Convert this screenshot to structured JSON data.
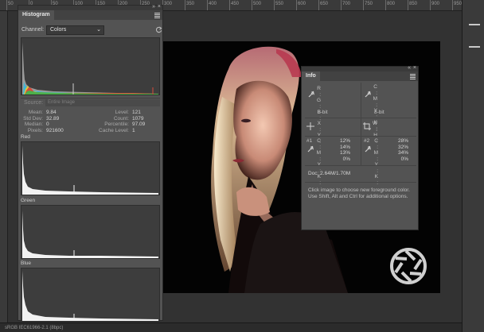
{
  "rulers": {
    "top_labels": [
      "50",
      "0",
      "50",
      "100",
      "150",
      "200",
      "250",
      "300",
      "350",
      "400",
      "450",
      "500",
      "550",
      "600",
      "650",
      "700",
      "750",
      "800",
      "850",
      "900",
      "950"
    ]
  },
  "status": {
    "text": "sRGB IEC61966-2.1 (8bpc)"
  },
  "histogram": {
    "tab": "Histogram",
    "channel_label": "Channel:",
    "channel_value": "Colors",
    "source_label": "Source:",
    "source_value": "Entire Image",
    "stats_left": [
      {
        "label": "Mean:",
        "value": "9.84"
      },
      {
        "label": "Std Dev:",
        "value": "32.89"
      },
      {
        "label": "Median:",
        "value": "0"
      },
      {
        "label": "Pixels:",
        "value": "921600"
      }
    ],
    "stats_right": [
      {
        "label": "Level:",
        "value": "121"
      },
      {
        "label": "Count:",
        "value": "1079"
      },
      {
        "label": "Percentile:",
        "value": "97.09"
      },
      {
        "label": "Cache Level:",
        "value": "1"
      }
    ],
    "channels": [
      "Red",
      "Green",
      "Blue"
    ]
  },
  "info": {
    "tab": "Info",
    "rgb_keys": [
      "R :",
      "G :",
      "B :"
    ],
    "cmyk_keys": [
      "C :",
      "M :",
      "Y :",
      "K :"
    ],
    "bit_depth": "8-bit",
    "xy_keys": [
      "X :",
      "Y :"
    ],
    "wh_keys": [
      "W :",
      "H :"
    ],
    "sample1": {
      "id": "#1",
      "keys": [
        "C :",
        "M :",
        "Y :",
        "K :"
      ],
      "values": [
        "12%",
        "14%",
        "13%",
        "0%"
      ]
    },
    "sample2": {
      "id": "#2",
      "keys": [
        "C :",
        "M :",
        "Y :",
        "K :"
      ],
      "values": [
        "28%",
        "32%",
        "34%",
        "0%"
      ]
    },
    "doc": "Doc: 2.64M/1.70M",
    "help": "Click image to choose new foreground color. Use Shift, Alt and Ctrl for additional options."
  },
  "colors": {
    "panel": "#535353",
    "workspace": "#323232",
    "image_bg": "#030303",
    "histo_bg": "#3d3d3d"
  }
}
